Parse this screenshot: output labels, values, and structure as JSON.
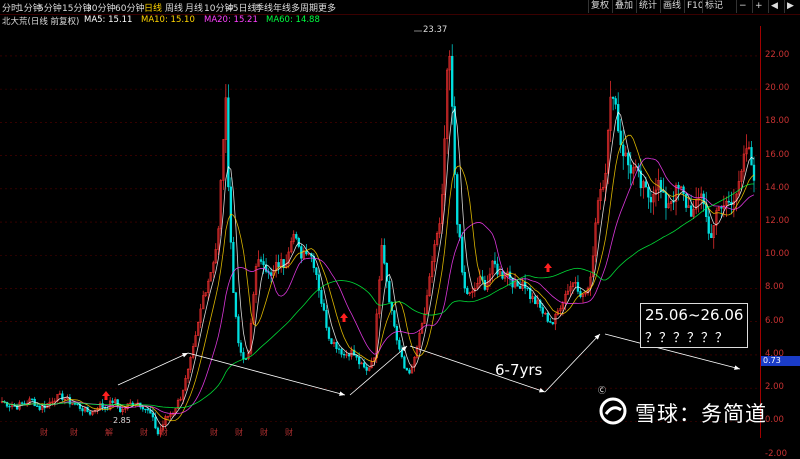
{
  "toolbar": {
    "timeframes": [
      "分时",
      "1分钟",
      "5分钟",
      "15分钟",
      "30分钟",
      "60分钟",
      "日线",
      "周线",
      "月线",
      "10分钟",
      "45日线",
      "季线",
      "年线",
      "多周期",
      "更多"
    ],
    "active": "日线",
    "right_buttons": [
      "复权",
      "叠加",
      "统计",
      "画线",
      "F10",
      "标记"
    ],
    "nav_icons": [
      "minus-icon",
      "plus-icon",
      "arrow-left-icon",
      "arrow-right-icon"
    ]
  },
  "legend": {
    "title": "北大荒(日线 前复权)",
    "ma5": "MA5: 15.11",
    "ma10": "MA10: 15.10",
    "ma20": "MA20: 15.21",
    "ma60": "MA60: 14.88"
  },
  "colors": {
    "up": "#ff3232",
    "down": "#00e0e0",
    "ma5": "#ffffff",
    "ma10": "#ffd400",
    "ma20": "#ff40ff",
    "ma60": "#00ff40",
    "axis": "#a00000"
  },
  "chart_data": {
    "type": "candlestick",
    "title": "北大荒(日线 前复权)",
    "ylim": [
      -1.0,
      23.8
    ],
    "y_ticks": [
      "22.00",
      "20.00",
      "18.00",
      "16.00",
      "14.00",
      "12.00",
      "10.00",
      "8.00",
      "6.00",
      "4.00",
      "2.00",
      "0.00",
      "-2.00"
    ],
    "approx_close_path": [
      1.2,
      1.0,
      0.9,
      1.1,
      1.3,
      0.8,
      1.0,
      1.4,
      1.5,
      1.2,
      1.0,
      0.7,
      0.5,
      1.0,
      0.8,
      1.3,
      0.6,
      1.0,
      1.2,
      0.9,
      0.4,
      -0.8,
      0.2,
      0.6,
      1.5,
      3.0,
      5.0,
      7.5,
      9.0,
      11.0,
      19.5,
      8.0,
      4.0,
      3.5,
      9.0,
      10.0,
      8.5,
      9.5,
      9.5,
      11.5,
      10.0,
      10.5,
      9.5,
      7.0,
      5.0,
      4.5,
      4.0,
      4.2,
      3.5,
      3.0,
      4.0,
      11.0,
      7.5,
      5.0,
      3.2,
      3.0,
      5.0,
      7.0,
      10.5,
      12.0,
      23.0,
      13.0,
      8.0,
      7.5,
      8.5,
      8.2,
      9.5,
      8.8,
      9.0,
      8.0,
      8.5,
      7.5,
      7.0,
      6.3,
      5.9,
      7.0,
      8.0,
      8.5,
      7.5,
      8.2,
      13.5,
      15.0,
      20.5,
      17.0,
      15.5,
      15.0,
      14.0,
      13.5,
      14.5,
      13.0,
      13.5,
      14.0,
      13.0,
      12.5,
      14.0,
      11.0,
      12.5,
      13.0,
      13.5,
      14.0,
      16.5,
      15.0
    ],
    "max_label": "23.37",
    "min_label": "2.85",
    "last_value_badge": "0.73",
    "annotations": [
      {
        "text": "25.06~26.06",
        "type": "box"
      },
      {
        "text": "？？？？？？",
        "type": "box"
      },
      {
        "text": "6-7yrs",
        "type": "text"
      }
    ],
    "markers": [
      {
        "type": "up-arrow"
      },
      {
        "type": "up-arrow"
      },
      {
        "type": "up-arrow"
      }
    ]
  },
  "watermark": {
    "text": "雪球：务简道",
    "sub": "Ⓒ"
  },
  "events": [
    "财",
    "财",
    "解",
    "财",
    "财",
    "财",
    "财",
    "财",
    "财"
  ]
}
